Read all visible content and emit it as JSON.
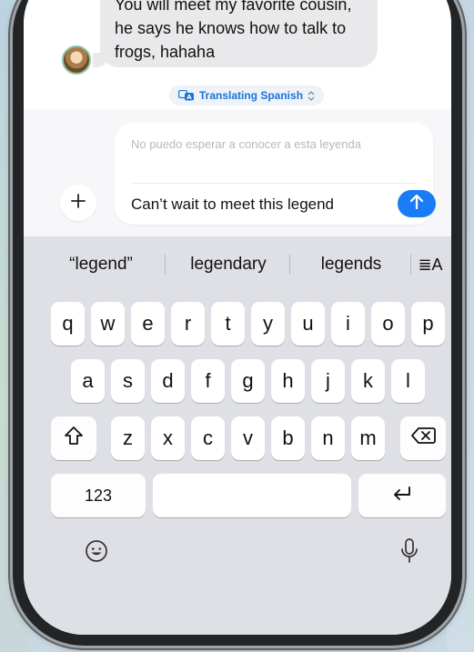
{
  "chat": {
    "incoming_message": "You will meet my favorite cousin, he says he knows how to talk to frogs, hahaha",
    "translation_status": "Translating Spanish"
  },
  "compose": {
    "original_text": "No puedo esperar a conocer a esta leyenda",
    "typed_text": "Can’t wait to meet this legend"
  },
  "keyboard": {
    "suggestions": [
      "“legend”",
      "legendary",
      "legends"
    ],
    "rows": [
      [
        "q",
        "w",
        "e",
        "r",
        "t",
        "y",
        "u",
        "i",
        "o",
        "p"
      ],
      [
        "a",
        "s",
        "d",
        "f",
        "g",
        "h",
        "j",
        "k",
        "l"
      ],
      [
        "z",
        "x",
        "c",
        "v",
        "b",
        "n",
        "m"
      ]
    ],
    "numbers_key": "123",
    "text_options_label": "≣A"
  },
  "icons": {
    "attach": "plus-icon",
    "send": "arrow-up-icon",
    "translate": "translate-icon",
    "shift": "shift-icon",
    "delete": "delete-icon",
    "return": "return-icon",
    "emoji": "emoji-icon",
    "dictation": "microphone-icon",
    "text_options": "text-format-icon"
  },
  "colors": {
    "accent": "#1a7cf5",
    "translate_text": "#1a74d6",
    "bubble": "#e9e9eb",
    "keyboard_bg": "#dfe0e5"
  }
}
